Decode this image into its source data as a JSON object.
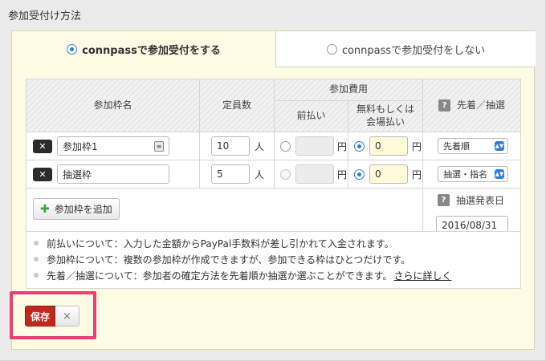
{
  "section": {
    "title": "参加受付け方法"
  },
  "tabs": [
    {
      "label": "connpassで参加受付をする",
      "active": true
    },
    {
      "label": "connpassで参加受付をしない",
      "active": false
    }
  ],
  "table": {
    "headers": {
      "frame_name": "参加枠名",
      "capacity": "定員数",
      "fee": "参加費用",
      "prepay": "前払い",
      "free_or_onsite_line1": "無料もしくは",
      "free_or_onsite_line2": "会場払い",
      "selection": "先着／抽選"
    },
    "rows": [
      {
        "name": "参加枠1",
        "capacity": "10",
        "capacity_unit": "人",
        "prepay_unit": "円",
        "onsite_value": "0",
        "onsite_unit": "円",
        "method": "先着順"
      },
      {
        "name": "抽選枠",
        "capacity": "5",
        "capacity_unit": "人",
        "prepay_unit": "円",
        "onsite_value": "0",
        "onsite_unit": "円",
        "method": "抽選・指名"
      }
    ],
    "add_button": "参加枠を追加",
    "lottery_date_label": "抽選発表日",
    "lottery_date": "2016/08/31"
  },
  "notes": [
    "前払いについて：入力した金額からPayPal手数料が差し引かれて入金されます。",
    "参加枠について：複数の参加枠が作成できますが、参加できる枠はひとつだけです。",
    "先着／抽選について：参加者の確定方法を先着順か抽選か選ぶことができます。"
  ],
  "notes_link": "さらに詳しく",
  "actions": {
    "save": "保存",
    "cancel": "×"
  },
  "colors": {
    "accent_blue": "#2c7be5",
    "save_red": "#c0281e",
    "highlight_pink": "#ee3c79",
    "panel_bg": "#fdfbe4"
  }
}
